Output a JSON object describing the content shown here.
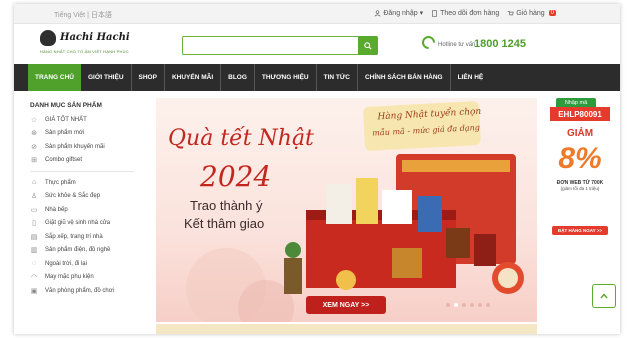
{
  "topbar": {
    "languages": "Tiếng Việt | 日本語",
    "login": "Đăng nhập",
    "track_order": "Theo dõi đơn hàng",
    "cart": "Giỏ hàng",
    "cart_count": "0"
  },
  "header": {
    "logo_name": "Hachi Hachi",
    "logo_tagline": "HÀNG NHẬT CHO TỔ ẤM VIỆT HẠNH PHÚC",
    "search_placeholder": "",
    "hotline_label": "Hotline tư vấn",
    "hotline_number": "1800 1245"
  },
  "nav": {
    "items": [
      {
        "label": "TRANG CHỦ",
        "active": true
      },
      {
        "label": "GIỚI THIỆU",
        "active": false
      },
      {
        "label": "SHOP",
        "active": false
      },
      {
        "label": "KHUYẾN MÃI",
        "active": false
      },
      {
        "label": "BLOG",
        "active": false
      },
      {
        "label": "THƯƠNG HIỆU",
        "active": false
      },
      {
        "label": "TIN TỨC",
        "active": false
      },
      {
        "label": "CHÍNH SÁCH BÁN HÀNG",
        "active": false
      },
      {
        "label": "LIÊN HỆ",
        "active": false
      }
    ]
  },
  "sidebar": {
    "heading": "DANH MỤC SẢN PHẨM",
    "group1": [
      {
        "label": "GIÁ TỐT NHẤT",
        "icon": "star-icon",
        "glyph": "☆"
      },
      {
        "label": "Sản phẩm mới",
        "icon": "new-badge-icon",
        "glyph": "⊛"
      },
      {
        "label": "Sản phẩm khuyến mãi",
        "icon": "tag-icon",
        "glyph": "⊘"
      },
      {
        "label": "Combo giftset",
        "icon": "gift-icon",
        "glyph": "⊞"
      }
    ],
    "group2": [
      {
        "label": "Thực phẩm",
        "icon": "food-icon",
        "glyph": "⌂"
      },
      {
        "label": "Sức khỏe & Sắc đẹp",
        "icon": "health-icon",
        "glyph": "♙"
      },
      {
        "label": "Nhà bếp",
        "icon": "kitchen-icon",
        "glyph": "▭"
      },
      {
        "label": "Giặt giũ vệ sinh nhà cửa",
        "icon": "laundry-icon",
        "glyph": "▯"
      },
      {
        "label": "Sắp xếp, trang trí nhà",
        "icon": "decor-icon",
        "glyph": "▤"
      },
      {
        "label": "Sản phẩm điện, đồ nghề",
        "icon": "electric-icon",
        "glyph": "▥"
      },
      {
        "label": "Ngoài trời, đi lại",
        "icon": "outdoor-icon",
        "glyph": "◌"
      },
      {
        "label": "May mặc phụ kiện",
        "icon": "clothing-icon",
        "glyph": "◠"
      },
      {
        "label": "Văn phòng phẩm, đồ chơi",
        "icon": "stationery-icon",
        "glyph": "▣"
      }
    ]
  },
  "banner": {
    "note_line1": "Hàng Nhật tuyển chọn",
    "note_line2": "mẫu mã - mức giá đa dạng",
    "title": "Quà tết Nhật",
    "year": "2024",
    "line1": "Trao thành ý",
    "line2": "Kết thâm giao",
    "cta": "XEM NGAY >>",
    "slides": 6,
    "active_slide": 1
  },
  "promo": {
    "code_label": "Nhập mã",
    "code": "EHLP80091",
    "giam": "GIẢM",
    "percent": "8%",
    "desc1": "ĐƠN WEB TỪ 700K",
    "desc2": "(giảm tối đa 1 triệu)",
    "button": "ĐẶT HÀNG NGAY >>"
  },
  "colors": {
    "brand_green": "#4fa12c",
    "nav_dark": "#2c2c2c",
    "banner_red": "#c2261e",
    "promo_red": "#e53b2c",
    "promo_orange": "#ef7b2a"
  }
}
